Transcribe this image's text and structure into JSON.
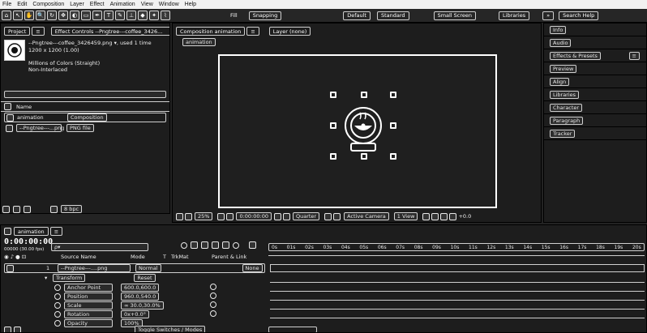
{
  "menu": [
    "File",
    "Edit",
    "Composition",
    "Layer",
    "Effect",
    "Animation",
    "View",
    "Window",
    "Help"
  ],
  "toolbar": {
    "tools": [
      "⌂",
      "↖",
      "✋",
      "🔍",
      "↻",
      "✥",
      "◐",
      "▭",
      "✒",
      "T",
      "✎",
      "⊥",
      "◆",
      "✦",
      "⌇"
    ],
    "fill_label": "Fill",
    "snapping_label": "Snapping",
    "workspaces": [
      "Default",
      "Standard",
      "Small Screen",
      "Libraries"
    ],
    "more": "»",
    "search_help": "Search Help"
  },
  "project": {
    "tab_label": "Project",
    "menu": "≡",
    "effect_controls": "Effect Controls --Pngtree---coffee_3426...",
    "asset_name": "--Pngtree---coffee_3426459.png ▾, used 1 time",
    "asset_size": "1200 x 1200 (1.00)",
    "asset_colors": "Millions of Colors (Straight)",
    "asset_interp": "Non-Interlaced",
    "search_placeholder": "",
    "col_name": "Name",
    "items": [
      {
        "name": "animation",
        "type": "Composition",
        "size": ""
      },
      {
        "name": "--Pngtree---...png",
        "type": "PNG file",
        "size": ""
      }
    ],
    "bpc": "8 bpc"
  },
  "composition": {
    "tab_label": "Composition animation",
    "menu": "≡",
    "layer_tab": "Layer (none)",
    "breadcrumb": "animation",
    "zoom": "25%",
    "timecode": "0:00:00:00",
    "quality": "Quarter",
    "view": "Active Camera",
    "views": "1 View",
    "exposure": "+0.0"
  },
  "right_panel": [
    "Info",
    "Audio",
    "Effects & Presets",
    "Preview",
    "Align",
    "Libraries",
    "Character",
    "Paragraph",
    "Tracker"
  ],
  "timeline": {
    "tab_label": "animation",
    "timecode": "0:00:00:00",
    "fps": "00000 (30.00 fps)",
    "search_placeholder": "ρ▾",
    "col_source": "Source Name",
    "col_mode": "Mode",
    "col_t": "T",
    "col_trkmat": "TrkMat",
    "col_parent": "Parent & Link",
    "layer_index": "1",
    "layer_name": "--Pngtree---....png",
    "layer_mode": "Normal",
    "layer_parent": "None",
    "transform_label": "Transform",
    "reset_label": "Reset",
    "props": [
      {
        "name": "Anchor Point",
        "value": "600.0,600.0"
      },
      {
        "name": "Position",
        "value": "960.0,540.0"
      },
      {
        "name": "Scale",
        "value": "∞ 30.0,30.0%"
      },
      {
        "name": "Rotation",
        "value": "0x+0.0°"
      },
      {
        "name": "Opacity",
        "value": "100%"
      }
    ],
    "ruler_marks": [
      "0s",
      "01s",
      "02s",
      "03s",
      "04s",
      "05s",
      "06s",
      "07s",
      "08s",
      "09s",
      "10s",
      "11s",
      "12s",
      "13s",
      "14s",
      "15s",
      "16s",
      "17s",
      "18s",
      "19s",
      "20s"
    ],
    "toggle_label": "Toggle Switches / Modes"
  },
  "colors": {
    "bg": "#232323",
    "panel": "#1d1d1d",
    "menubar": "#f1f1f1",
    "stroke": "#ffffff",
    "comp_bg": "#1f1f1f"
  }
}
